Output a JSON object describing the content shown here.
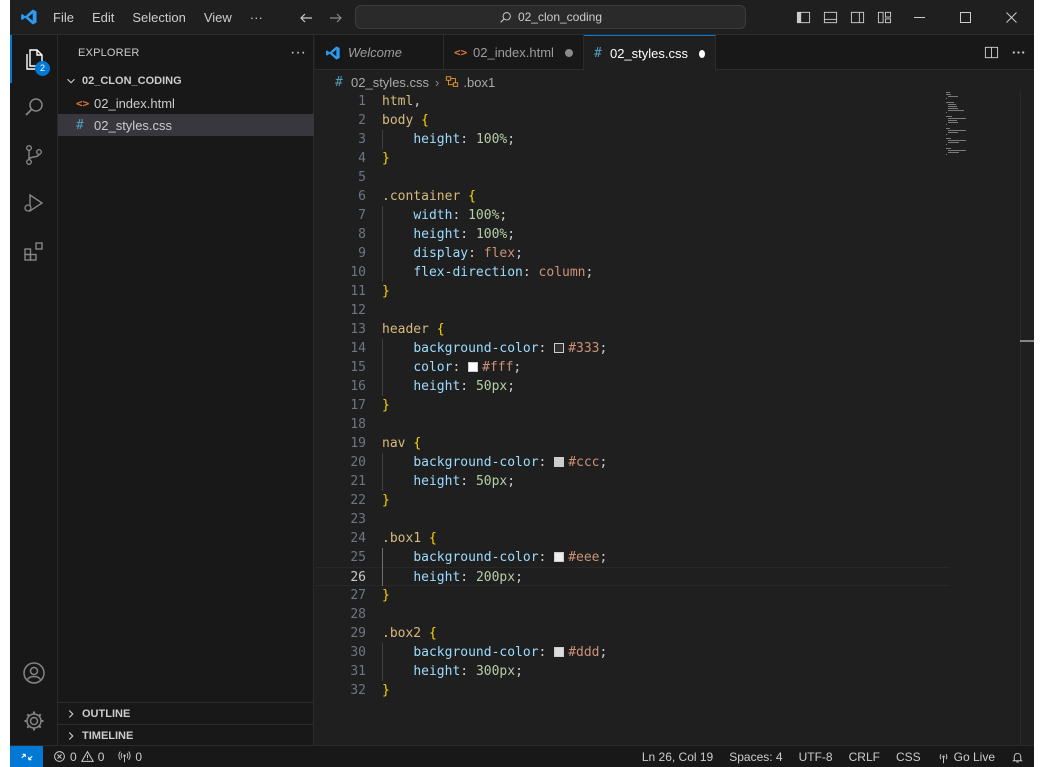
{
  "titlebar": {
    "menu": [
      "File",
      "Edit",
      "Selection",
      "View",
      "···"
    ],
    "search": "02_clon_coding"
  },
  "activity": {
    "explorer_badge": "2"
  },
  "sidebar": {
    "title": "EXPLORER",
    "more": "···",
    "folder": "02_CLON_CODING",
    "files": [
      {
        "name": "02_index.html",
        "type": "html"
      },
      {
        "name": "02_styles.css",
        "type": "css"
      }
    ],
    "panels": [
      "OUTLINE",
      "TIMELINE"
    ]
  },
  "tabs": [
    {
      "label": "Welcome"
    },
    {
      "label": "02_index.html"
    },
    {
      "label": "02_styles.css"
    }
  ],
  "breadcrumb": {
    "file": "02_styles.css",
    "symbol": ".box1"
  },
  "code": {
    "current_line": 26,
    "lines": [
      "html,",
      "body {",
      "    height: 100%;",
      "}",
      "",
      ".container {",
      "    width: 100%;",
      "    height: 100%;",
      "    display: flex;",
      "    flex-direction: column;",
      "}",
      "",
      "header {",
      "    background-color: #333;",
      "    color: #fff;",
      "    height: 50px;",
      "}",
      "",
      "nav {",
      "    background-color: #ccc;",
      "    height: 50px;",
      "}",
      "",
      ".box1 {",
      "    background-color: #eee;",
      "    height: 200px;",
      "}",
      "",
      ".box2 {",
      "    background-color: #ddd;",
      "    height: 300px;",
      "}"
    ]
  },
  "statusbar": {
    "errors": "0",
    "warnings": "0",
    "ports": "0",
    "position": "Ln 26, Col 19",
    "spaces": "Spaces: 4",
    "encoding": "UTF-8",
    "eol": "CRLF",
    "language": "CSS",
    "golive": "Go Live"
  },
  "colors": {
    "accent": "#0078d4",
    "selector": "#d7ba7d",
    "property": "#9cdcfe",
    "number": "#b5cea8",
    "value": "#ce9178",
    "brace": "#ffd700"
  }
}
